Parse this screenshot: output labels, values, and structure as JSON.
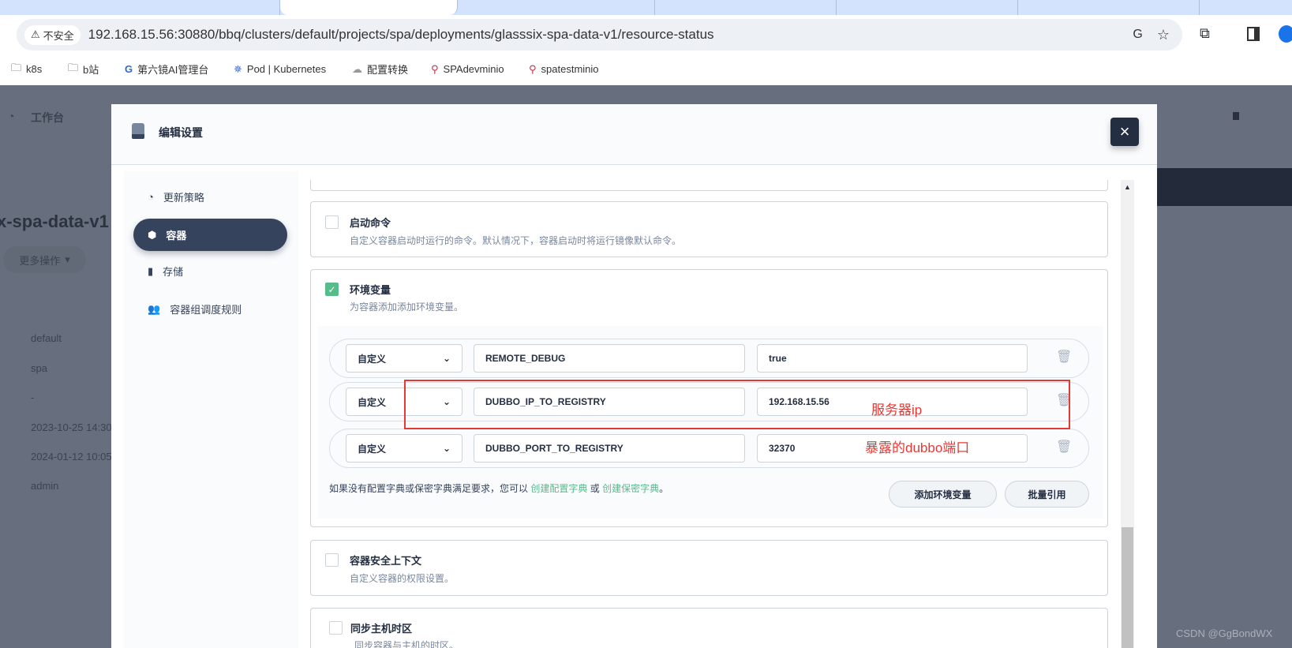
{
  "browser": {
    "security_label": "不安全",
    "url": "192.168.15.56:30880/bbq/clusters/default/projects/spa/deployments/glasssix-spa-data-v1/resource-status",
    "bookmarks": [
      {
        "label": "k8s",
        "icon": "folder-icon"
      },
      {
        "label": "b站",
        "icon": "folder-icon"
      },
      {
        "label": "第六镜AI管理台",
        "icon": "g-logo-icon"
      },
      {
        "label": "Pod | Kubernetes",
        "icon": "kubernetes-icon"
      },
      {
        "label": "配置转换",
        "icon": "cloud-icon"
      },
      {
        "label": "SPAdevminio",
        "icon": "minio-icon"
      },
      {
        "label": "spatestminio",
        "icon": "minio-icon"
      }
    ]
  },
  "background": {
    "workbench": "工作台",
    "deployment_title": "x-spa-data-v1",
    "more_actions": "更多操作",
    "details": [
      "default",
      "spa",
      "-",
      "2023-10-25 14:30",
      "2024-01-12 10:05",
      "admin"
    ]
  },
  "modal": {
    "title": "编辑设置",
    "close": "×",
    "nav": [
      "更新策略",
      "容器",
      "存储",
      "容器组调度规则"
    ],
    "cards": {
      "start_cmd": {
        "title": "启动命令",
        "desc": "自定义容器启动时运行的命令。默认情况下，容器启动时将运行镜像默认命令。",
        "checked": false
      },
      "env": {
        "title": "环境变量",
        "desc": "为容器添加添加环境变量。",
        "checked": true
      },
      "security": {
        "title": "容器安全上下文",
        "desc": "自定义容器的权限设置。",
        "checked": false
      },
      "timezone": {
        "title": "同步主机时区",
        "desc": "同步容器与主机的时区。",
        "checked": false
      }
    },
    "env_vars": [
      {
        "type": "自定义",
        "key": "REMOTE_DEBUG",
        "value": "true"
      },
      {
        "type": "自定义",
        "key": "DUBBO_IP_TO_REGISTRY",
        "value": "192.168.15.56"
      },
      {
        "type": "自定义",
        "key": "DUBBO_PORT_TO_REGISTRY",
        "value": "32370"
      }
    ],
    "footer": {
      "text": "如果没有配置字典或保密字典满足要求，您可以",
      "link1": "创建配置字典",
      "or": "或",
      "link2": "创建保密字典",
      "end": "。"
    },
    "add_env": "添加环境变量",
    "batch_ref": "批量引用"
  },
  "annotations": {
    "ip": "服务器ip",
    "port": "暴露的dubbo端口"
  },
  "watermark": "CSDN @GgBondWX",
  "colors": {
    "accent": "#55bc8a",
    "dark": "#242e42",
    "annotation": "#e53935"
  }
}
